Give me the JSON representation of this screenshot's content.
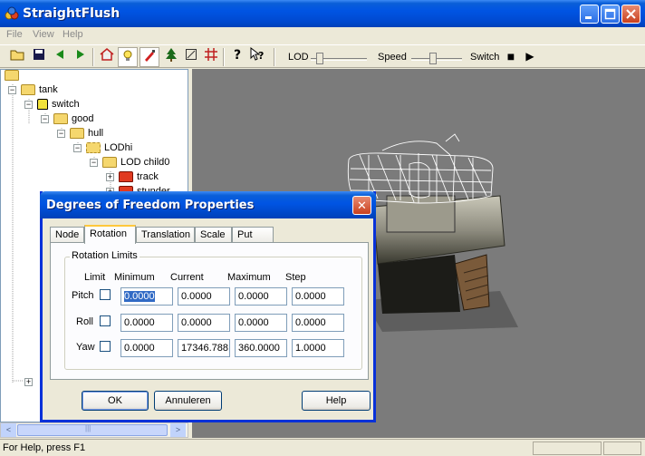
{
  "window": {
    "title": "StraightFlush"
  },
  "menu": {
    "items": [
      "File",
      "View",
      "Help"
    ]
  },
  "toolbar": {
    "icons": [
      "open-icon",
      "save-icon",
      "back-icon",
      "forward-icon",
      "home-icon",
      "light-icon",
      "paint-icon",
      "tree-icon",
      "resize-icon",
      "grid-icon",
      "help-icon",
      "context-help-icon"
    ],
    "lod_label": "LOD",
    "speed_label": "Speed",
    "switch_label": "Switch",
    "stop_symbol": "■",
    "play_symbol": "▶"
  },
  "tree": {
    "nodes": [
      {
        "label": "tank"
      },
      {
        "label": "switch"
      },
      {
        "label": "good"
      },
      {
        "label": "hull"
      },
      {
        "label": "LODhi"
      },
      {
        "label": "LOD child0"
      },
      {
        "label": "track"
      },
      {
        "label": "stunder"
      }
    ],
    "expander_minus": "−",
    "expander_plus": "+"
  },
  "scrollbar": {
    "left_arrow": "<",
    "right_arrow": ">",
    "grip": "|||"
  },
  "status": {
    "text": "For Help, press F1"
  },
  "dialog": {
    "title": "Degrees of Freedom Properties",
    "close_symbol": "✕",
    "tabs": [
      "Node",
      "Rotation",
      "Translation",
      "Scale",
      "Put"
    ],
    "active_tab": "Rotation",
    "group_label": "Rotation Limits",
    "columns": {
      "limit": "Limit",
      "minimum": "Minimum",
      "current": "Current",
      "maximum": "Maximum",
      "step": "Step"
    },
    "rows": [
      {
        "label": "Pitch",
        "minimum": "0.0000",
        "current": "0.0000",
        "maximum": "0.0000",
        "step": "0.0000"
      },
      {
        "label": "Roll",
        "minimum": "0.0000",
        "current": "0.0000",
        "maximum": "0.0000",
        "step": "0.0000"
      },
      {
        "label": "Yaw",
        "minimum": "0.0000",
        "current": "17346.788",
        "maximum": "360.0000",
        "step": "1.0000"
      }
    ],
    "buttons": {
      "ok": "OK",
      "cancel": "Annuleren",
      "help": "Help"
    }
  },
  "colors": {
    "titlebar": "#0054e3",
    "viewport_bg": "#7b7b7b",
    "selection": "#316ac5"
  }
}
